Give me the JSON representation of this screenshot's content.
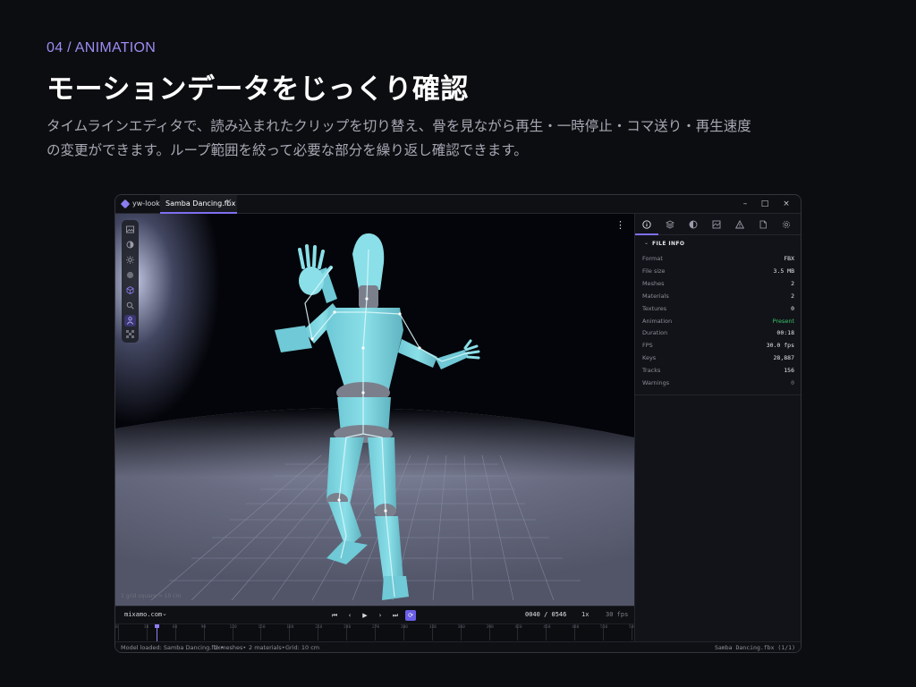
{
  "header": {
    "section_label": "04 / ANIMATION",
    "title": "モーションデータをじっくり確認",
    "description_lines": [
      "タイムラインエディタで、読み込まれたクリップを切り替え、骨を見ながら再生・一時停止・コマ送り・再生速度",
      "の変更ができます。ループ範囲を絞って必要な部分を繰り返し確認できます。"
    ]
  },
  "app": {
    "name": "yw-look",
    "tab_label": "Samba Dancing.fbx",
    "tab_close": "×",
    "window_controls": {
      "minimize": "–",
      "maximize": "□",
      "close": "×"
    },
    "accent_color": "#7d6ff0"
  },
  "viewport": {
    "menu_icon": "⋮",
    "grid_note": "1 grid square = 10 cm",
    "tools": [
      {
        "icon": "image-icon"
      },
      {
        "icon": "circle-icon"
      },
      {
        "icon": "sun-icon"
      },
      {
        "icon": "sphere-icon"
      },
      {
        "icon": "cube-icon"
      },
      {
        "icon": "search-icon"
      },
      {
        "icon": "person-icon",
        "active": true
      },
      {
        "icon": "checker-icon"
      }
    ]
  },
  "transport": {
    "source": "mixamo.com",
    "source_caret": "⌄",
    "buttons": {
      "first": "⏮",
      "prev": "‹",
      "play": "▶",
      "next": "›",
      "last": "⏭",
      "loop": "⟳"
    },
    "frame": "0040 / 0546",
    "speed": "1x",
    "fps": "30 fps"
  },
  "timeline": {
    "ticks": [
      "0",
      "30",
      "60",
      "90",
      "120",
      "150",
      "180",
      "210",
      "240",
      "270",
      "300",
      "330",
      "360",
      "390",
      "420",
      "450",
      "480",
      "510",
      "540"
    ],
    "current_frame": 40,
    "total_frames": 546
  },
  "statusbar": {
    "model": "Model loaded: Samba Dancing.fbx•",
    "meshes": "2 meshes•",
    "materials": "2 materials•",
    "grid": "Grid: 10 cm",
    "right": "Samba Dancing.fbx (1/1)"
  },
  "panel": {
    "tabs": [
      "info-icon",
      "layers-icon",
      "material-icon",
      "texture-icon",
      "warning-icon",
      "file-icon",
      "settings-icon"
    ],
    "section_caret": "⌄",
    "section_title": "FILE INFO",
    "rows": [
      {
        "key": "Format",
        "value": "FBX"
      },
      {
        "key": "File size",
        "value": "3.5 MB"
      },
      {
        "key": "Meshes",
        "value": "2"
      },
      {
        "key": "Materials",
        "value": "2"
      },
      {
        "key": "Textures",
        "value": "0"
      },
      {
        "key": "Animation",
        "value": "Present",
        "status_color": "#38c46a"
      },
      {
        "key": "Duration",
        "value": "00:18"
      },
      {
        "key": "FPS",
        "value": "30.0 fps"
      },
      {
        "key": "Keys",
        "value": "28,887"
      },
      {
        "key": "Tracks",
        "value": "156"
      },
      {
        "key": "Warnings",
        "value": "0"
      }
    ]
  }
}
